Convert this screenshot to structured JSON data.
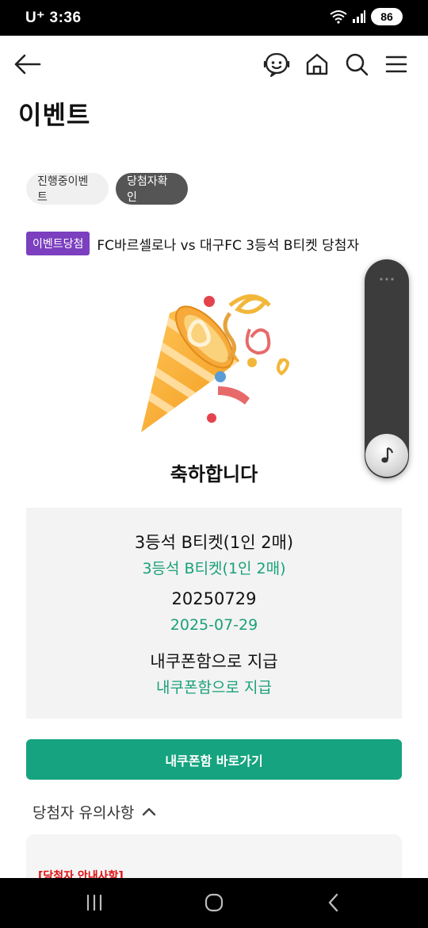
{
  "status_bar": {
    "carrier": "U⁺ 3:36",
    "battery": "86"
  },
  "header": {
    "back_icon": "back-arrow-icon",
    "icons": [
      "chatbot-icon",
      "home-icon",
      "search-icon",
      "menu-icon"
    ]
  },
  "page": {
    "title": "이벤트"
  },
  "tabs": [
    {
      "label": "진행중이벤트",
      "active": false
    },
    {
      "label": "당첨자확인",
      "active": true
    }
  ],
  "event": {
    "badge": "이벤트당첨",
    "title": "FC바르셀로나 vs 대구FC 3등석 B티켓 당첨자"
  },
  "congrats": "축하합니다",
  "prize": {
    "item_label": "3등석 B티켓(1인 2매)",
    "item_value": "3등석 B티켓(1인 2매)",
    "date_label": "20250729",
    "date_value": "2025-07-29",
    "method_label": "내쿠폰함으로 지급",
    "method_value": "내쿠폰함으로 지급"
  },
  "coupon_button": "내쿠폰함 바로가기",
  "notice": {
    "header": "당첨자 유의사항",
    "box_title": "[당첨자 안내사항]"
  },
  "colors": {
    "accent_green": "#16a37f",
    "badge_purple": "#7b3fbf",
    "notice_red": "#e01010"
  }
}
